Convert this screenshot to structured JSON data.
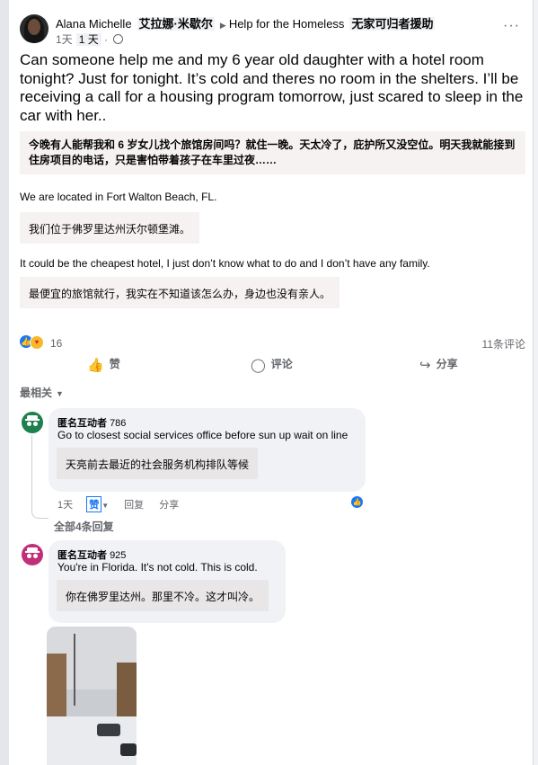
{
  "post": {
    "author": "Alana Michelle",
    "author_translation": "艾拉娜·米歇尔",
    "group": "Help for the Homeless",
    "group_translation": "无家可归者援助",
    "time": "1天",
    "time_translation": "1 天",
    "more_label": "···",
    "text": "Can someone help me and my 6 year old daughter with a hotel room tonight? Just for tonight. It’s cold and theres no room in the shelters. I’ll be receiving a call for a housing program tomorrow, just scared to sleep in the car with her..",
    "text_translation": "今晚有人能帮我和 6 岁女儿找个旅馆房间吗？就住一晚。天太冷了，庇护所又没空位。明天我就能接到住房项目的电话，只是害怕带着孩子在车里过夜……",
    "para2": "We are located in Fort Walton Beach, FL.",
    "para2_translation": "我们位于佛罗里达州沃尔顿堡滩。",
    "para3": "It could be the cheapest hotel, I just don’t know what to do and I don’t have any family.",
    "para3_translation": "最便宜的旅馆就行，我实在不知道该怎么办，身边也没有亲人。"
  },
  "stats": {
    "reaction_count": "16",
    "comments_label": "11条评论"
  },
  "actions": {
    "like": "赞",
    "comment": "评论",
    "share": "分享"
  },
  "sort_label": "最相关",
  "comments": [
    {
      "author": "匿名互动者",
      "author_num": "786",
      "body": "Go to closest social services office before sun up wait on line",
      "translation": "天亮前去最近的社会服务机构排队等候",
      "time": "1天",
      "like": "赞",
      "reply": "回复",
      "share": "分享",
      "avatar_color": "#1e7f4f"
    },
    {
      "author": "匿名互动者",
      "author_num": "925",
      "body": "You're in Florida. It's not cold. This is cold.",
      "translation": "你在佛罗里达州。那里不冷。这才叫冷。",
      "avatar_color": "#c0307a"
    }
  ],
  "all_replies_label": "全部4条回复",
  "colors": {
    "accent": "#1877f2",
    "muted": "#65676b",
    "translation_bg": "#f7f2f2"
  },
  "icons": {
    "like": "thumbs-up-icon",
    "comment": "speech-bubble-icon",
    "share": "share-arrow-icon",
    "privacy": "globe-icon"
  }
}
